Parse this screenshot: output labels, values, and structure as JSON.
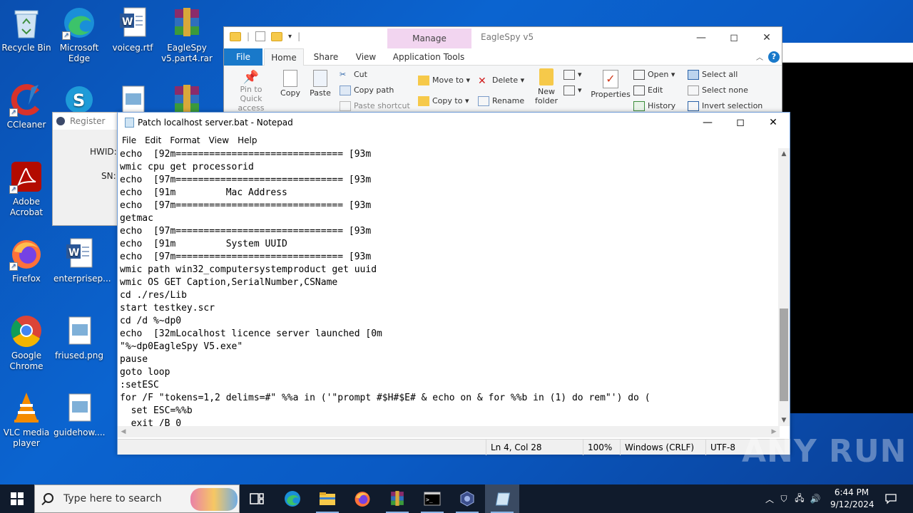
{
  "desktop": {
    "icons": [
      {
        "label": "Recycle Bin"
      },
      {
        "label": "Microsoft Edge"
      },
      {
        "label": "voiceg.rtf"
      },
      {
        "label": "EagleSpy v5.part4.rar"
      },
      {
        "label": "CCleaner"
      },
      {
        "label": "Adobe Acrobat"
      },
      {
        "label": "Firefox"
      },
      {
        "label": "enterprisep..."
      },
      {
        "label": "Google Chrome"
      },
      {
        "label": "friused.png"
      },
      {
        "label": "VLC media player"
      },
      {
        "label": "guidehow...."
      }
    ]
  },
  "explorer": {
    "title": "EagleSpy v5",
    "manage_tab": "Manage",
    "tabs": [
      "File",
      "Home",
      "Share",
      "View",
      "Application Tools"
    ],
    "ribbon": {
      "pin": "Pin to Quick access",
      "copy": "Copy",
      "paste": "Paste",
      "cut": "Cut",
      "copy_path": "Copy path",
      "paste_shortcut": "Paste shortcut",
      "move_to": "Move to",
      "copy_to": "Copy to",
      "delete": "Delete",
      "rename": "Rename",
      "new_folder": "New folder",
      "properties": "Properties",
      "open": "Open",
      "edit": "Edit",
      "history": "History",
      "select_all": "Select all",
      "select_none": "Select none",
      "invert_selection": "Invert selection"
    }
  },
  "register": {
    "title": "Register",
    "hwid_label": "HWID:",
    "sn_label": "SN:"
  },
  "notepad": {
    "title": "Patch localhost server.bat - Notepad",
    "menu": [
      "File",
      "Edit",
      "Format",
      "View",
      "Help"
    ],
    "lines": [
      "echo  [92m============================== [93m",
      "wmic cpu get processorid",
      "echo  [97m============================== [93m",
      "echo  [91m         Mac Address",
      "echo  [97m============================== [93m",
      "getmac",
      "echo  [97m============================== [93m",
      "echo  [91m         System UUID",
      "echo  [97m============================== [93m",
      "wmic path win32_computersystemproduct get uuid",
      "wmic OS GET Caption,SerialNumber,CSName",
      "cd ./res/Lib",
      "start testkey.scr",
      "cd /d %~dp0",
      "echo  [32mLocalhost licence server launched [0m",
      "\"%~dp0EagleSpy V5.exe\"",
      "pause",
      "goto loop",
      ":setESC",
      "for /F \"tokens=1,2 delims=#\" %%a in ('\"prompt #$H#$E# & echo on & for %%b in (1) do rem\"') do (",
      "  set ESC=%%b",
      "  exit /B 0"
    ],
    "status": {
      "position": "Ln 4, Col 28",
      "zoom": "100%",
      "line_ending": "Windows (CRLF)",
      "encoding": "UTF-8"
    }
  },
  "watermark": "ANY RUN",
  "taskbar": {
    "search_placeholder": "Type here to search",
    "time": "6:44 PM",
    "date": "9/12/2024"
  }
}
